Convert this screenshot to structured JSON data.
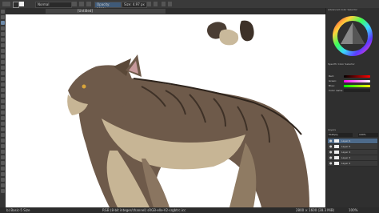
{
  "toolbar": {
    "blend_mode": "Normal",
    "opacity": "Opacity: 100%",
    "size": "Size: 4.97 px"
  },
  "document_tab": {
    "title": "[Untitled]"
  },
  "dock": {
    "advanced_color_selector_title": "Advanced Color Selector",
    "specific_color_selector_title": "Specific Color Selector",
    "slider_labels": [
      "Red:",
      "Green:",
      "Blue:"
    ],
    "slider_values": [
      "",
      "",
      ""
    ],
    "color_name_label": "Color name",
    "color_name_value": "",
    "layers_title": "Layers",
    "layers_blend": "Multiply",
    "layers": [
      "Layer 6",
      "Layer 5",
      "Layer 4",
      "Layer 3",
      "Layer 2"
    ],
    "selected_layer_index": 0,
    "layer_opacity": "100%"
  },
  "statusbar": {
    "brush": "b) Basic-5 Size",
    "color_info": "RGB (8-bit integer/channel) sRGB-elle-V2-srgbtrc.icc",
    "dimensions": "2800 × 1600 (28.3 MiB)",
    "zoom": "100%"
  },
  "colors": {
    "ui_dark": "#2f2f2f",
    "canvas_bg": "#ffffff",
    "fur_dark": "#6e5a4a",
    "fur_light": "#c7b595",
    "fur_shade": "#4a3a2e",
    "accent": "#4d6a8a",
    "ear_pink": "#c6999b"
  }
}
